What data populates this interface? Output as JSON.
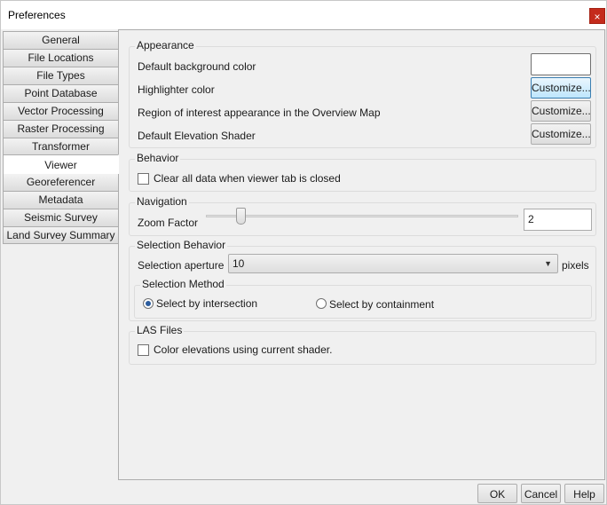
{
  "window": {
    "title": "Preferences",
    "close_glyph": "×"
  },
  "tabs": [
    {
      "label": "General",
      "active": false
    },
    {
      "label": "File Locations",
      "active": false
    },
    {
      "label": "File Types",
      "active": false
    },
    {
      "label": "Point Database",
      "active": false
    },
    {
      "label": "Vector Processing",
      "active": false
    },
    {
      "label": "Raster Processing",
      "active": false
    },
    {
      "label": "Transformer",
      "active": false
    },
    {
      "label": "Viewer",
      "active": true
    },
    {
      "label": "Georeferencer",
      "active": false
    },
    {
      "label": "Metadata",
      "active": false
    },
    {
      "label": "Seismic Survey",
      "active": false
    },
    {
      "label": "Land Survey Summary",
      "active": false
    }
  ],
  "appearance": {
    "legend": "Appearance",
    "default_bg_label": "Default background color",
    "default_bg_color": "#ffffff",
    "highlighter_label": "Highlighter color",
    "roi_label": "Region of interest appearance in the Overview Map",
    "elevation_label": "Default Elevation Shader",
    "customize_label": "Customize..."
  },
  "behavior": {
    "legend": "Behavior",
    "clear_data_label": "Clear all data when viewer tab is closed",
    "clear_data_checked": false
  },
  "navigation": {
    "legend": "Navigation",
    "zoom_label": "Zoom Factor",
    "zoom_value": "2"
  },
  "selection": {
    "legend": "Selection Behavior",
    "aperture_label": "Selection aperture",
    "aperture_value": "10",
    "aperture_unit": "pixels",
    "method_legend": "Selection Method",
    "intersection_label": "Select by intersection",
    "intersection_checked": true,
    "containment_label": "Select by containment",
    "containment_checked": false
  },
  "las": {
    "legend": "LAS Files",
    "color_elev_label": "Color elevations using current shader.",
    "color_elev_checked": false
  },
  "footer": {
    "ok_label": "OK",
    "cancel_label": "Cancel",
    "help_label": "Help"
  },
  "colors": {
    "accent": "#3c7fb1",
    "close_red": "#c42b1c",
    "panel_bg": "#f0f0f0"
  }
}
